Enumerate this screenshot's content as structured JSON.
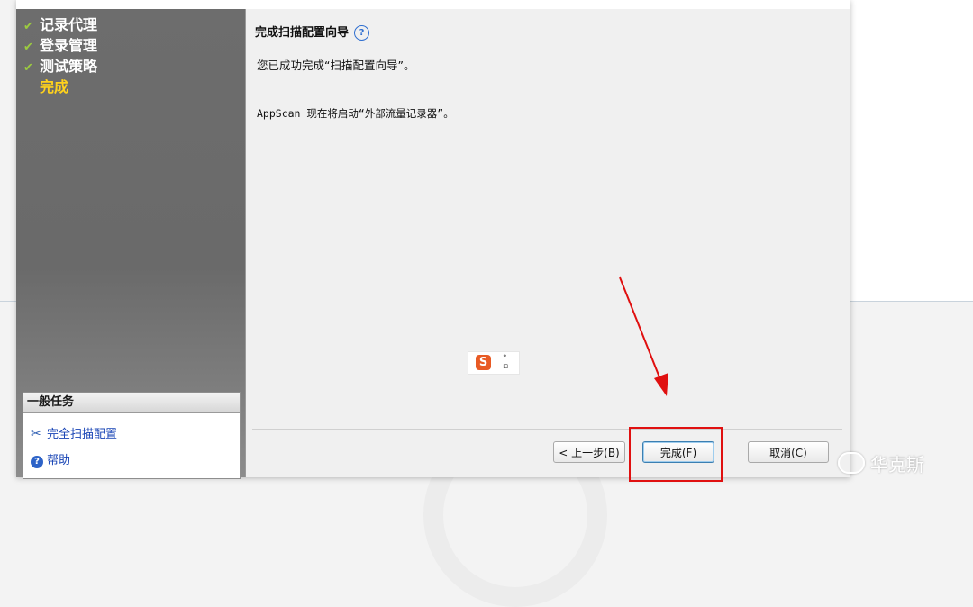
{
  "steps": [
    {
      "label": "记录代理",
      "done": true
    },
    {
      "label": "登录管理",
      "done": true
    },
    {
      "label": "测试策略",
      "done": true
    },
    {
      "label": "完成",
      "done": false,
      "current": true
    }
  ],
  "tasks": {
    "title": "一般任务",
    "items": [
      {
        "label": "完全扫描配置",
        "icon": "tools-icon"
      },
      {
        "label": "帮助",
        "icon": "help-icon"
      }
    ]
  },
  "content": {
    "title": "完成扫描配置向导",
    "message": "您已成功完成“扫描配置向导”。",
    "message2": "AppScan 现在将启动“外部流量记录器”。"
  },
  "buttons": {
    "back": "< 上一步(B)",
    "finish": "完成(F)",
    "cancel": "取消(C)"
  },
  "watermark": "华克斯",
  "colors": {
    "accent_current_step": "#ffd21c",
    "check_green": "#9ccb3f",
    "annotation_red": "#e01010",
    "link_blue": "#1844b5"
  }
}
